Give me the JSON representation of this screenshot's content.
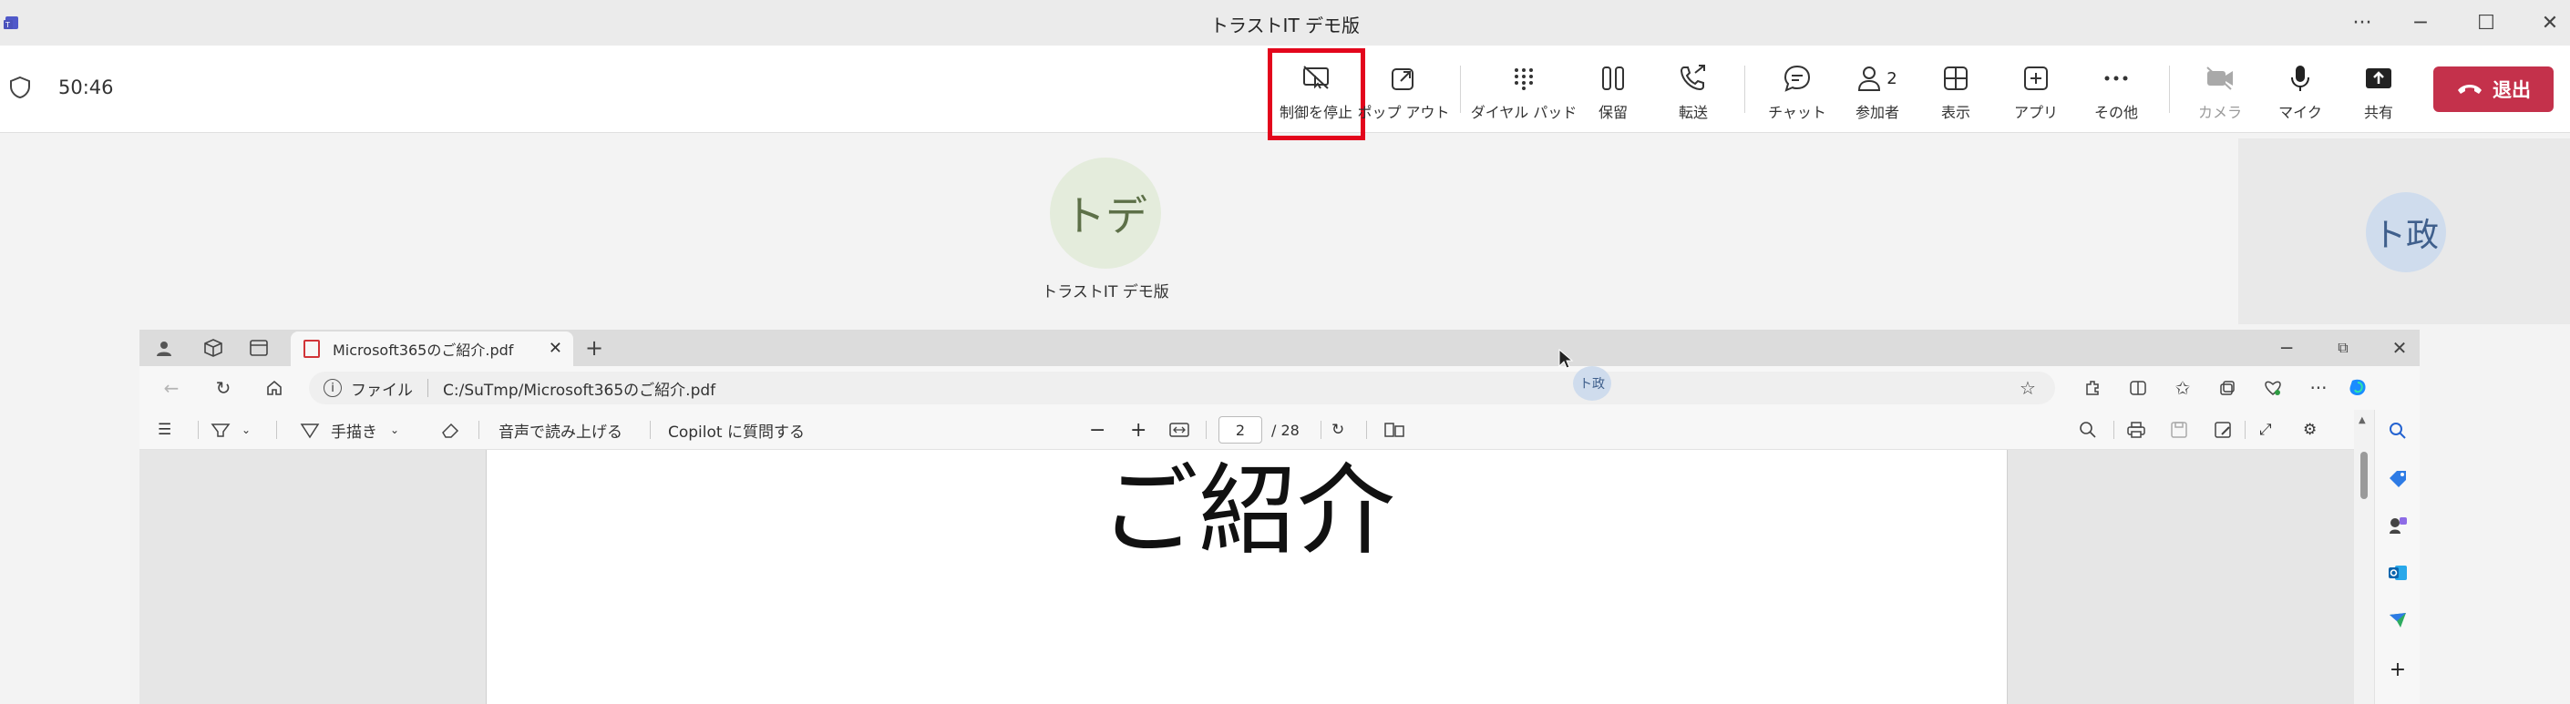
{
  "window": {
    "title": "トラストIT デモ版",
    "more": "···",
    "minimize": "─",
    "maximize": "☐",
    "close": "✕"
  },
  "meeting": {
    "timer": "50:46",
    "buttons": [
      {
        "name": "stop-control",
        "label": "制御を停止",
        "icon": "screen-stop-icon"
      },
      {
        "name": "popout",
        "label": "ポップ アウト",
        "icon": "popout-icon"
      },
      {
        "name": "dialpad",
        "label": "ダイヤル パッド",
        "icon": "dialpad-icon"
      },
      {
        "name": "hold",
        "label": "保留",
        "icon": "pause-icon"
      },
      {
        "name": "transfer",
        "label": "転送",
        "icon": "phone-forward-icon"
      },
      {
        "name": "chat",
        "label": "チャット",
        "icon": "chat-icon"
      },
      {
        "name": "participants",
        "label": "参加者",
        "icon": "people-icon",
        "count": "2"
      },
      {
        "name": "view",
        "label": "表示",
        "icon": "grid-icon"
      },
      {
        "name": "apps",
        "label": "アプリ",
        "icon": "add-icon"
      },
      {
        "name": "more",
        "label": "その他",
        "icon": "ellipsis-icon"
      },
      {
        "name": "camera",
        "label": "カメラ",
        "icon": "camera-off-icon",
        "disabled": true
      },
      {
        "name": "mic",
        "label": "マイク",
        "icon": "mic-icon"
      },
      {
        "name": "share",
        "label": "共有",
        "icon": "share-icon"
      }
    ],
    "leave_label": "退出",
    "leave_color": "#c4314b",
    "highlight_color": "#e3061c"
  },
  "participants": {
    "main": {
      "initials": "トデ",
      "name": "トラストIT デモ版"
    },
    "self": {
      "initials": "ト政"
    }
  },
  "browser": {
    "tab_title": "Microsoft365のご紹介.pdf",
    "tab_close": "✕",
    "new_tab": "+",
    "address_prefix": "ファイル",
    "address": "C:/SuTmp/Microsoft365のご紹介.pdf",
    "presenter_badge": "ト政",
    "pdf_toolbar": {
      "draw": "手描き",
      "read_aloud": "音声で読み上げる",
      "copilot": "Copilot に質問する",
      "page": "2",
      "total_pages": "/ 28",
      "zoom_out": "−",
      "zoom_in": "+"
    },
    "document_heading": "ご紹介"
  }
}
